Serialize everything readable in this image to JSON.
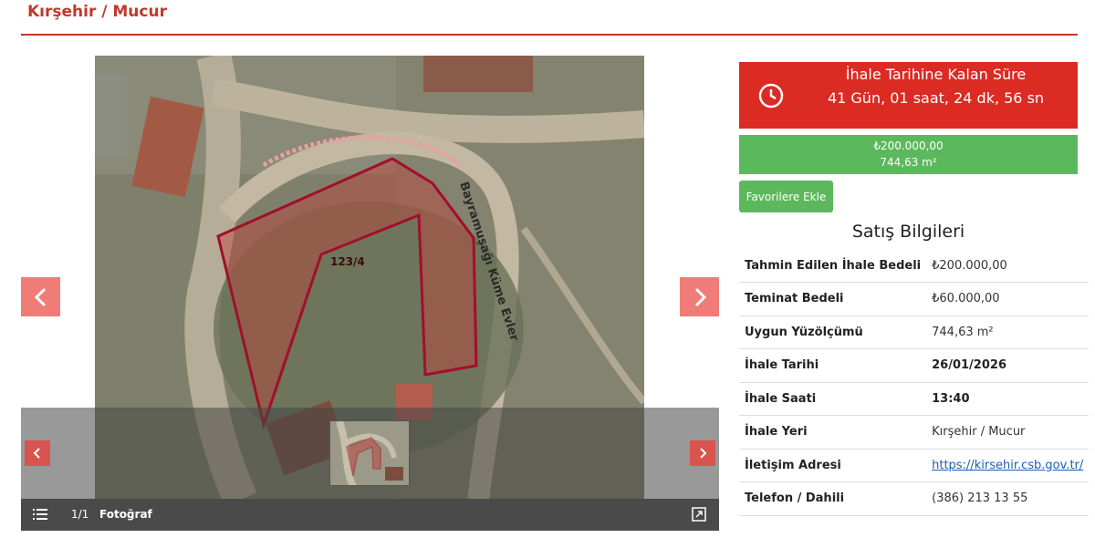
{
  "header": {
    "title": "Kırşehir / Mucur"
  },
  "gallery": {
    "map_parcel_label": "123/4",
    "map_road_label": "Bayramuşağı Küme Evler",
    "counter": "1/1",
    "label": "Fotoğraf",
    "icons": [
      "chevron-left-icon",
      "chevron-right-icon",
      "list-icon",
      "expand-icon"
    ]
  },
  "countdown": {
    "title": "İhale Tarihine Kalan Süre",
    "value": "41 Gün, 01 saat, 24 dk, 56 sn",
    "icon": "clock-icon",
    "color": "#dc2b23"
  },
  "price": {
    "amount": "₺200.000,00",
    "area": "744,63 m²",
    "color": "#5cb85c"
  },
  "favorite_button": "Favorilere Ekle",
  "sales_info": {
    "title": "Satış Bilgileri",
    "rows": [
      {
        "label": "Tahmin Edilen İhale Bedeli",
        "value": "₺200.000,00"
      },
      {
        "label": "Teminat Bedeli",
        "value": "₺60.000,00"
      },
      {
        "label": "Uygun Yüzölçümü",
        "value": "744,63 m²"
      },
      {
        "label": "İhale Tarihi",
        "value": "26/01/2026"
      },
      {
        "label": "İhale Saati",
        "value": "13:40"
      },
      {
        "label": "İhale Yeri",
        "value": "Kırşehir / Mucur"
      },
      {
        "label": "İletişim Adresi",
        "value": "https://kirsehir.csb.gov.tr/"
      },
      {
        "label": "Telefon / Dahili",
        "value": "(386) 213 13 55"
      }
    ]
  }
}
